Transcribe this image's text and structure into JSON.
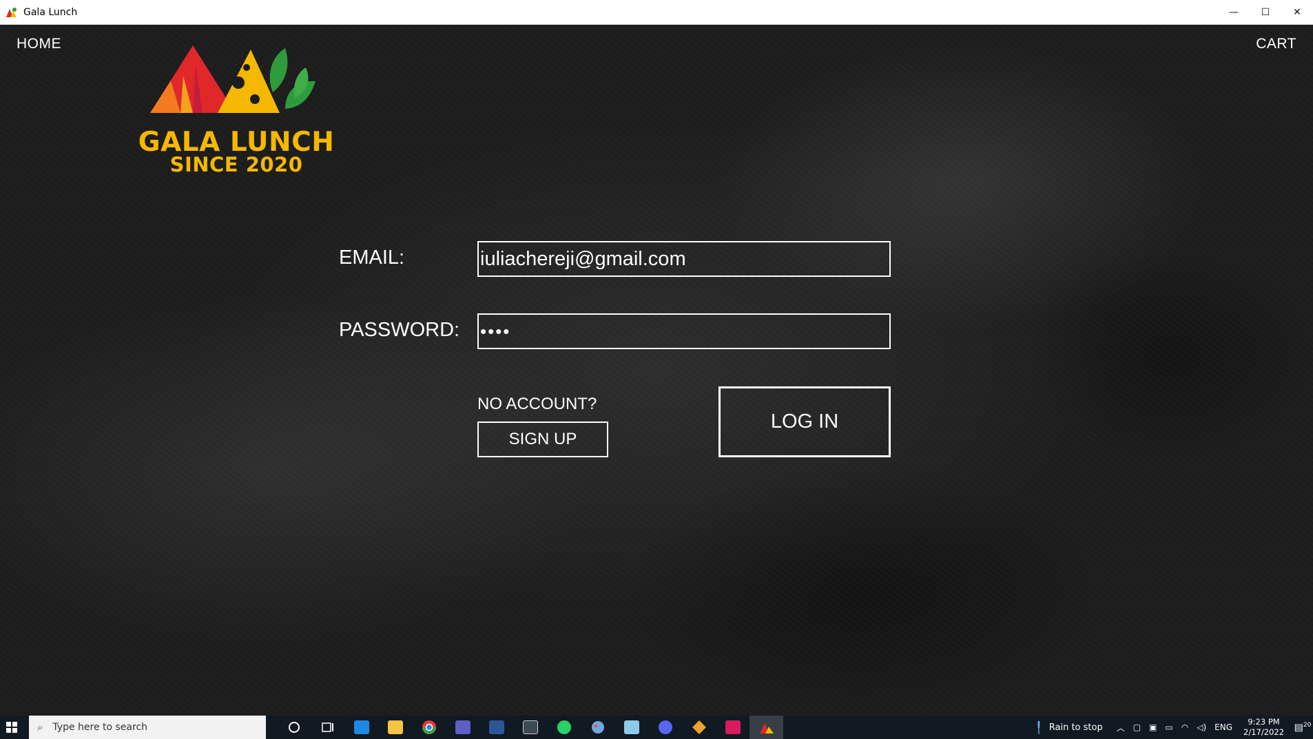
{
  "window": {
    "title": "Gala Lunch",
    "controls": {
      "minimize": "—",
      "maximize": "☐",
      "close": "✕"
    }
  },
  "nav": {
    "home_label": "HOME",
    "cart_label": "CART"
  },
  "logo": {
    "line1": "GALA LUNCH",
    "line2": "SINCE 2020",
    "accent_colors": [
      "#f5b800",
      "#e0272a",
      "#f47a1f",
      "#2e9b3c"
    ]
  },
  "login_form": {
    "email_label": "EMAIL:",
    "email_value": "iuliachereji@gmail.com",
    "password_label": "PASSWORD:",
    "password_value": "••••",
    "no_account_text": "NO ACCOUNT?",
    "signup_label": "SIGN UP",
    "login_label": "LOG IN"
  },
  "taskbar": {
    "search_placeholder": "Type here to search",
    "apps": [
      "cortana-icon",
      "task-view-icon",
      "store-icon",
      "file-explorer-icon",
      "chrome-icon",
      "teams-icon",
      "word-icon",
      "snipping-icon",
      "whatsapp-icon",
      "paint-icon",
      "notes-icon",
      "discord-icon",
      "git-icon",
      "intellij-icon",
      "gala-lunch-icon"
    ],
    "weather_text": "Rain to stop",
    "language": "ENG",
    "time": "9:23 PM",
    "date": "2/17/2022",
    "notification_count": "20"
  }
}
